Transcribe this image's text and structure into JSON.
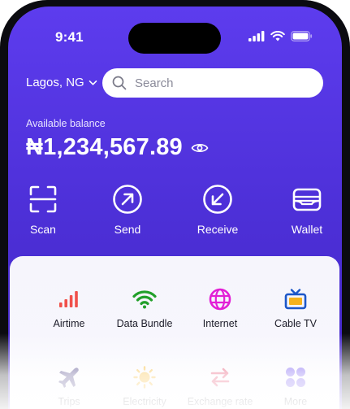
{
  "status_bar": {
    "time": "9:41"
  },
  "header": {
    "location": "Lagos, NG",
    "search_placeholder": "Search"
  },
  "balance": {
    "label": "Available balance",
    "amount": "₦1,234,567.89"
  },
  "actions": [
    {
      "label": "Scan",
      "icon": "scan-icon"
    },
    {
      "label": "Send",
      "icon": "send-icon"
    },
    {
      "label": "Receive",
      "icon": "receive-icon"
    },
    {
      "label": "Wallet",
      "icon": "wallet-icon"
    }
  ],
  "services": [
    {
      "label": "Airtime",
      "icon": "signal-bars-icon",
      "color": "#f0504a"
    },
    {
      "label": "Data Bundle",
      "icon": "wifi-icon",
      "color": "#22a02a"
    },
    {
      "label": "Internet",
      "icon": "globe-icon",
      "color": "#e21fd6"
    },
    {
      "label": "Cable TV",
      "icon": "tv-icon",
      "color": "#1c57c8"
    },
    {
      "label": "Trips",
      "icon": "airplane-icon",
      "color": "#3a2f7a"
    },
    {
      "label": "Electricity",
      "icon": "sun-icon",
      "color": "#f6b21c"
    },
    {
      "label": "Exchange rate",
      "icon": "exchange-icon",
      "color": "#e2395f"
    },
    {
      "label": "More",
      "icon": "grid-icon",
      "color": "#6c4cf0"
    }
  ],
  "colors": {
    "brand": "#5b3bea"
  }
}
